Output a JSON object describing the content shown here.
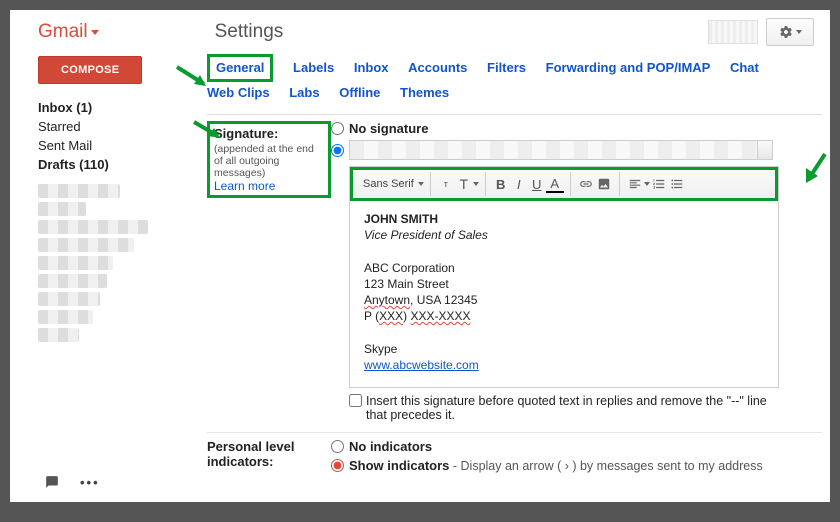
{
  "header": {
    "logo": "Gmail",
    "title": "Settings"
  },
  "sidebar": {
    "compose": "COMPOSE",
    "items": [
      {
        "label": "Inbox (1)",
        "bold": true
      },
      {
        "label": "Starred",
        "bold": false
      },
      {
        "label": "Sent Mail",
        "bold": false
      },
      {
        "label": "Drafts (110)",
        "bold": true
      }
    ]
  },
  "tabs": {
    "row1": [
      "General",
      "Labels",
      "Inbox",
      "Accounts",
      "Filters",
      "Forwarding and POP/IMAP",
      "Chat"
    ],
    "row2": [
      "Web Clips",
      "Labs",
      "Offline",
      "Themes"
    ],
    "active": "General"
  },
  "signature": {
    "heading": "Signature:",
    "sub": "(appended at the end of all outgoing messages)",
    "learn": "Learn more",
    "no_sig": "No signature",
    "font": "Sans Serif",
    "body": {
      "name": "JOHN SMITH",
      "title": "Vice President of Sales",
      "company": "ABC Corporation",
      "street": "123 Main Street",
      "city_pre": "Anytown",
      "city_post": ", USA 12345",
      "phone_p": "P (",
      "phone_a": "XXX",
      "phone_b": ") ",
      "phone_c": "XXX-XXXX",
      "skype": "Skype",
      "url": "www.abcwebsite.com"
    },
    "insert_before": "Insert this signature before quoted text in replies and remove the \"--\" line that precedes it."
  },
  "indicators": {
    "heading": "Personal level indicators:",
    "none": "No indicators",
    "show": "Show indicators",
    "show_desc": " - Display an arrow ( › ) by messages sent to my address"
  }
}
